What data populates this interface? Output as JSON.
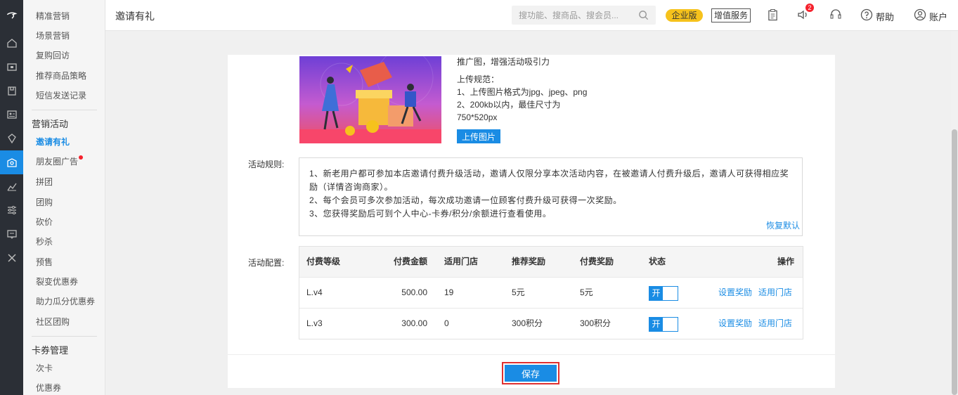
{
  "submenu": {
    "items_top": [
      "精准营销",
      "场景营销",
      "复购回访",
      "推荐商品策略",
      "短信发送记录"
    ],
    "group_marketing": "营销活动",
    "items_marketing": [
      "邀请有礼",
      "朋友圈广告",
      "拼团",
      "团购",
      "砍价",
      "秒杀",
      "预售",
      "裂变优惠券",
      "助力瓜分优惠券",
      "社区团购"
    ],
    "group_cards": "卡券管理",
    "items_cards": [
      "次卡",
      "优惠券"
    ]
  },
  "header": {
    "title": "邀请有礼",
    "search_placeholder": "搜功能、搜商品、搜会员...",
    "enterprise_badge": "企业版",
    "value_added": "增值服务",
    "notify_count": "2",
    "help": "帮助",
    "account": "账户"
  },
  "promo": {
    "title": "推广图，增强活动吸引力",
    "spec_title": "上传规范：",
    "spec_1": "1、上传图片格式为jpg、jpeg、png",
    "spec_2": "2、200kb以内，最佳尺寸为",
    "spec_3": "750*520px",
    "upload_label": "上传图片"
  },
  "rules": {
    "label": "活动规则:",
    "line_1": "1、新老用户都可参加本店邀请付费升级活动，邀请人仅限分享本次活动内容，在被邀请人付费升级后，邀请人可获得相应奖励（详情咨询商家）。",
    "line_2": "2、每个会员可多次参加活动，每次成功邀请一位顾客付费升级可获得一次奖励。",
    "line_3": "3、您获得奖励后可到个人中心-卡券/积分/余额进行查看使用。",
    "restore": "恢复默认"
  },
  "config": {
    "label": "活动配置:",
    "headers": {
      "level": "付费等级",
      "amount": "付费金额",
      "stores": "适用门店",
      "referral": "推荐奖励",
      "paid": "付费奖励",
      "status": "状态",
      "ops": "操作"
    },
    "rows": [
      {
        "level": "L.v4",
        "amount": "500.00",
        "stores": "19",
        "referral": "5元",
        "paid": "5元",
        "toggle": "开",
        "set_reward": "设置奖励",
        "apply_store": "适用门店"
      },
      {
        "level": "L.v3",
        "amount": "300.00",
        "stores": "0",
        "referral": "300积分",
        "paid": "300积分",
        "toggle": "开",
        "set_reward": "设置奖励",
        "apply_store": "适用门店"
      }
    ]
  },
  "save_label": "保存",
  "colors": {
    "accent": "#1a8ce4",
    "enterprise": "#f6c21c",
    "highlight": "#e03030",
    "rail": "#2b2f36"
  }
}
